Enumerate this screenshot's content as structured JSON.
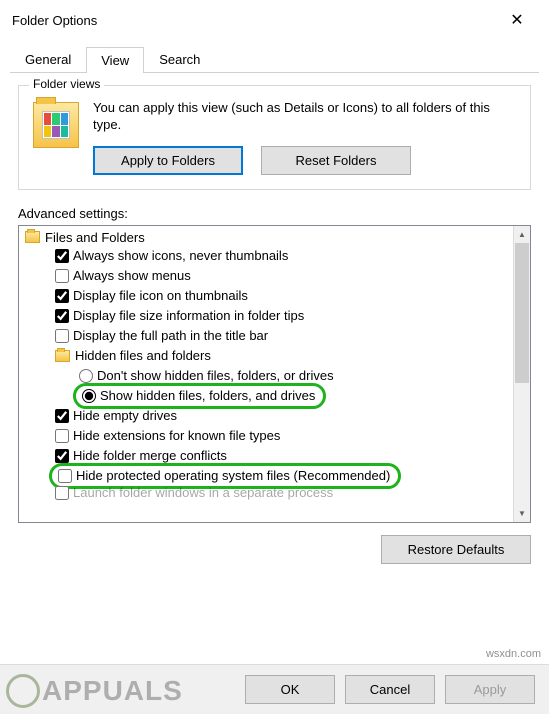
{
  "window": {
    "title": "Folder Options"
  },
  "tabs": {
    "general": "General",
    "view": "View",
    "search": "Search",
    "active": "view"
  },
  "folder_views": {
    "legend": "Folder views",
    "text": "You can apply this view (such as Details or Icons) to all folders of this type.",
    "apply_btn": "Apply to Folders",
    "reset_btn": "Reset Folders"
  },
  "advanced": {
    "label": "Advanced settings:",
    "root": "Files and Folders",
    "items": [
      {
        "type": "check",
        "checked": true,
        "label": "Always show icons, never thumbnails"
      },
      {
        "type": "check",
        "checked": false,
        "label": "Always show menus"
      },
      {
        "type": "check",
        "checked": true,
        "label": "Display file icon on thumbnails"
      },
      {
        "type": "check",
        "checked": true,
        "label": "Display file size information in folder tips"
      },
      {
        "type": "check",
        "checked": false,
        "label": "Display the full path in the title bar"
      },
      {
        "type": "folder",
        "label": "Hidden files and folders"
      },
      {
        "type": "radio",
        "checked": false,
        "label": "Don't show hidden files, folders, or drives",
        "level": 2
      },
      {
        "type": "radio",
        "checked": true,
        "label": "Show hidden files, folders, and drives",
        "level": 2,
        "highlight": true
      },
      {
        "type": "check",
        "checked": true,
        "label": "Hide empty drives"
      },
      {
        "type": "check",
        "checked": false,
        "label": "Hide extensions for known file types"
      },
      {
        "type": "check",
        "checked": true,
        "label": "Hide folder merge conflicts"
      },
      {
        "type": "check",
        "checked": false,
        "label": "Hide protected operating system files (Recommended)",
        "highlight": true
      },
      {
        "type": "check",
        "checked": false,
        "label": "Launch folder windows in a separate process",
        "cut": true
      }
    ],
    "restore_btn": "Restore Defaults"
  },
  "buttons": {
    "ok": "OK",
    "cancel": "Cancel",
    "apply": "Apply"
  },
  "watermark": "APPUALS",
  "url": "wsxdn.com"
}
